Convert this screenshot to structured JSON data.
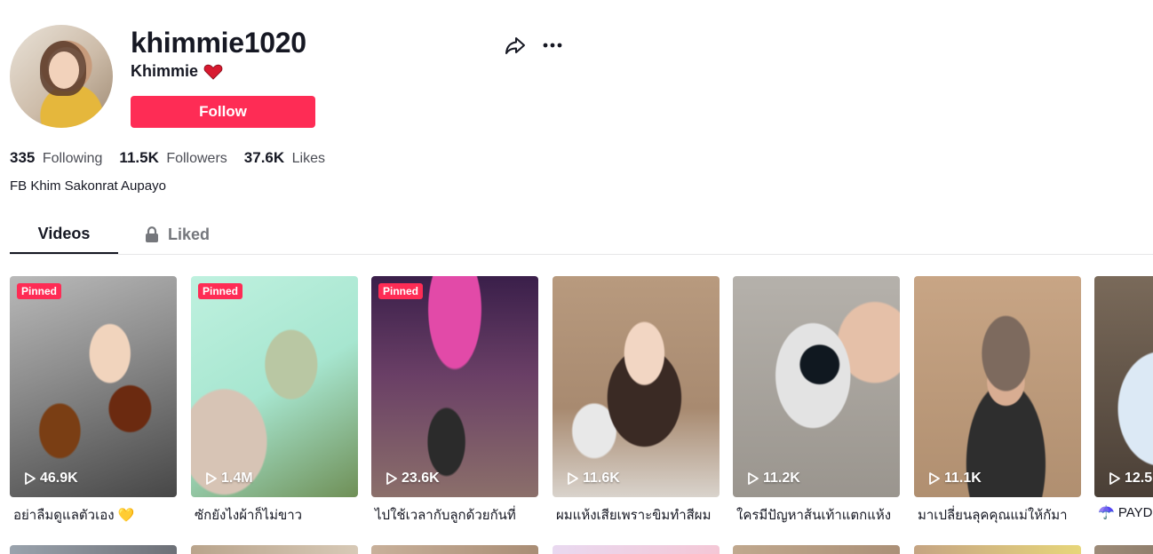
{
  "profile": {
    "username": "khimmie1020",
    "nickname": "Khimmie",
    "follow_label": "Follow",
    "bio": "FB Khim Sakonrat Aupayo"
  },
  "stats": [
    {
      "value": "335",
      "label": "Following"
    },
    {
      "value": "11.5K",
      "label": "Followers"
    },
    {
      "value": "37.6K",
      "label": "Likes"
    }
  ],
  "tabs": {
    "videos": "Videos",
    "liked": "Liked"
  },
  "videos": [
    {
      "views": "46.9K",
      "caption": "อย่าลืมดูแลตัวเอง 💛",
      "pinned": "Pinned"
    },
    {
      "views": "1.4M",
      "caption": "ซักยังไงผ้าก็ไม่ขาว",
      "pinned": "Pinned"
    },
    {
      "views": "23.6K",
      "caption": "ไปใช้เวลากับลูกด้วยกันที่",
      "pinned": "Pinned"
    },
    {
      "views": "11.6K",
      "caption": "ผมแห้งเสียเพราะขิมทำสีผม"
    },
    {
      "views": "11.2K",
      "caption": "ใครมีปัญหาส้นเท้าแตกแห้ง"
    },
    {
      "views": "11.1K",
      "caption": "มาเปลี่ยนลุคคุณแม่ให้กัมา"
    },
    {
      "views": "12.5",
      "caption": "☂️ PAYD"
    }
  ],
  "colors": {
    "accent": "#fe2c55",
    "text": "#161823",
    "muted": "#75777c"
  }
}
